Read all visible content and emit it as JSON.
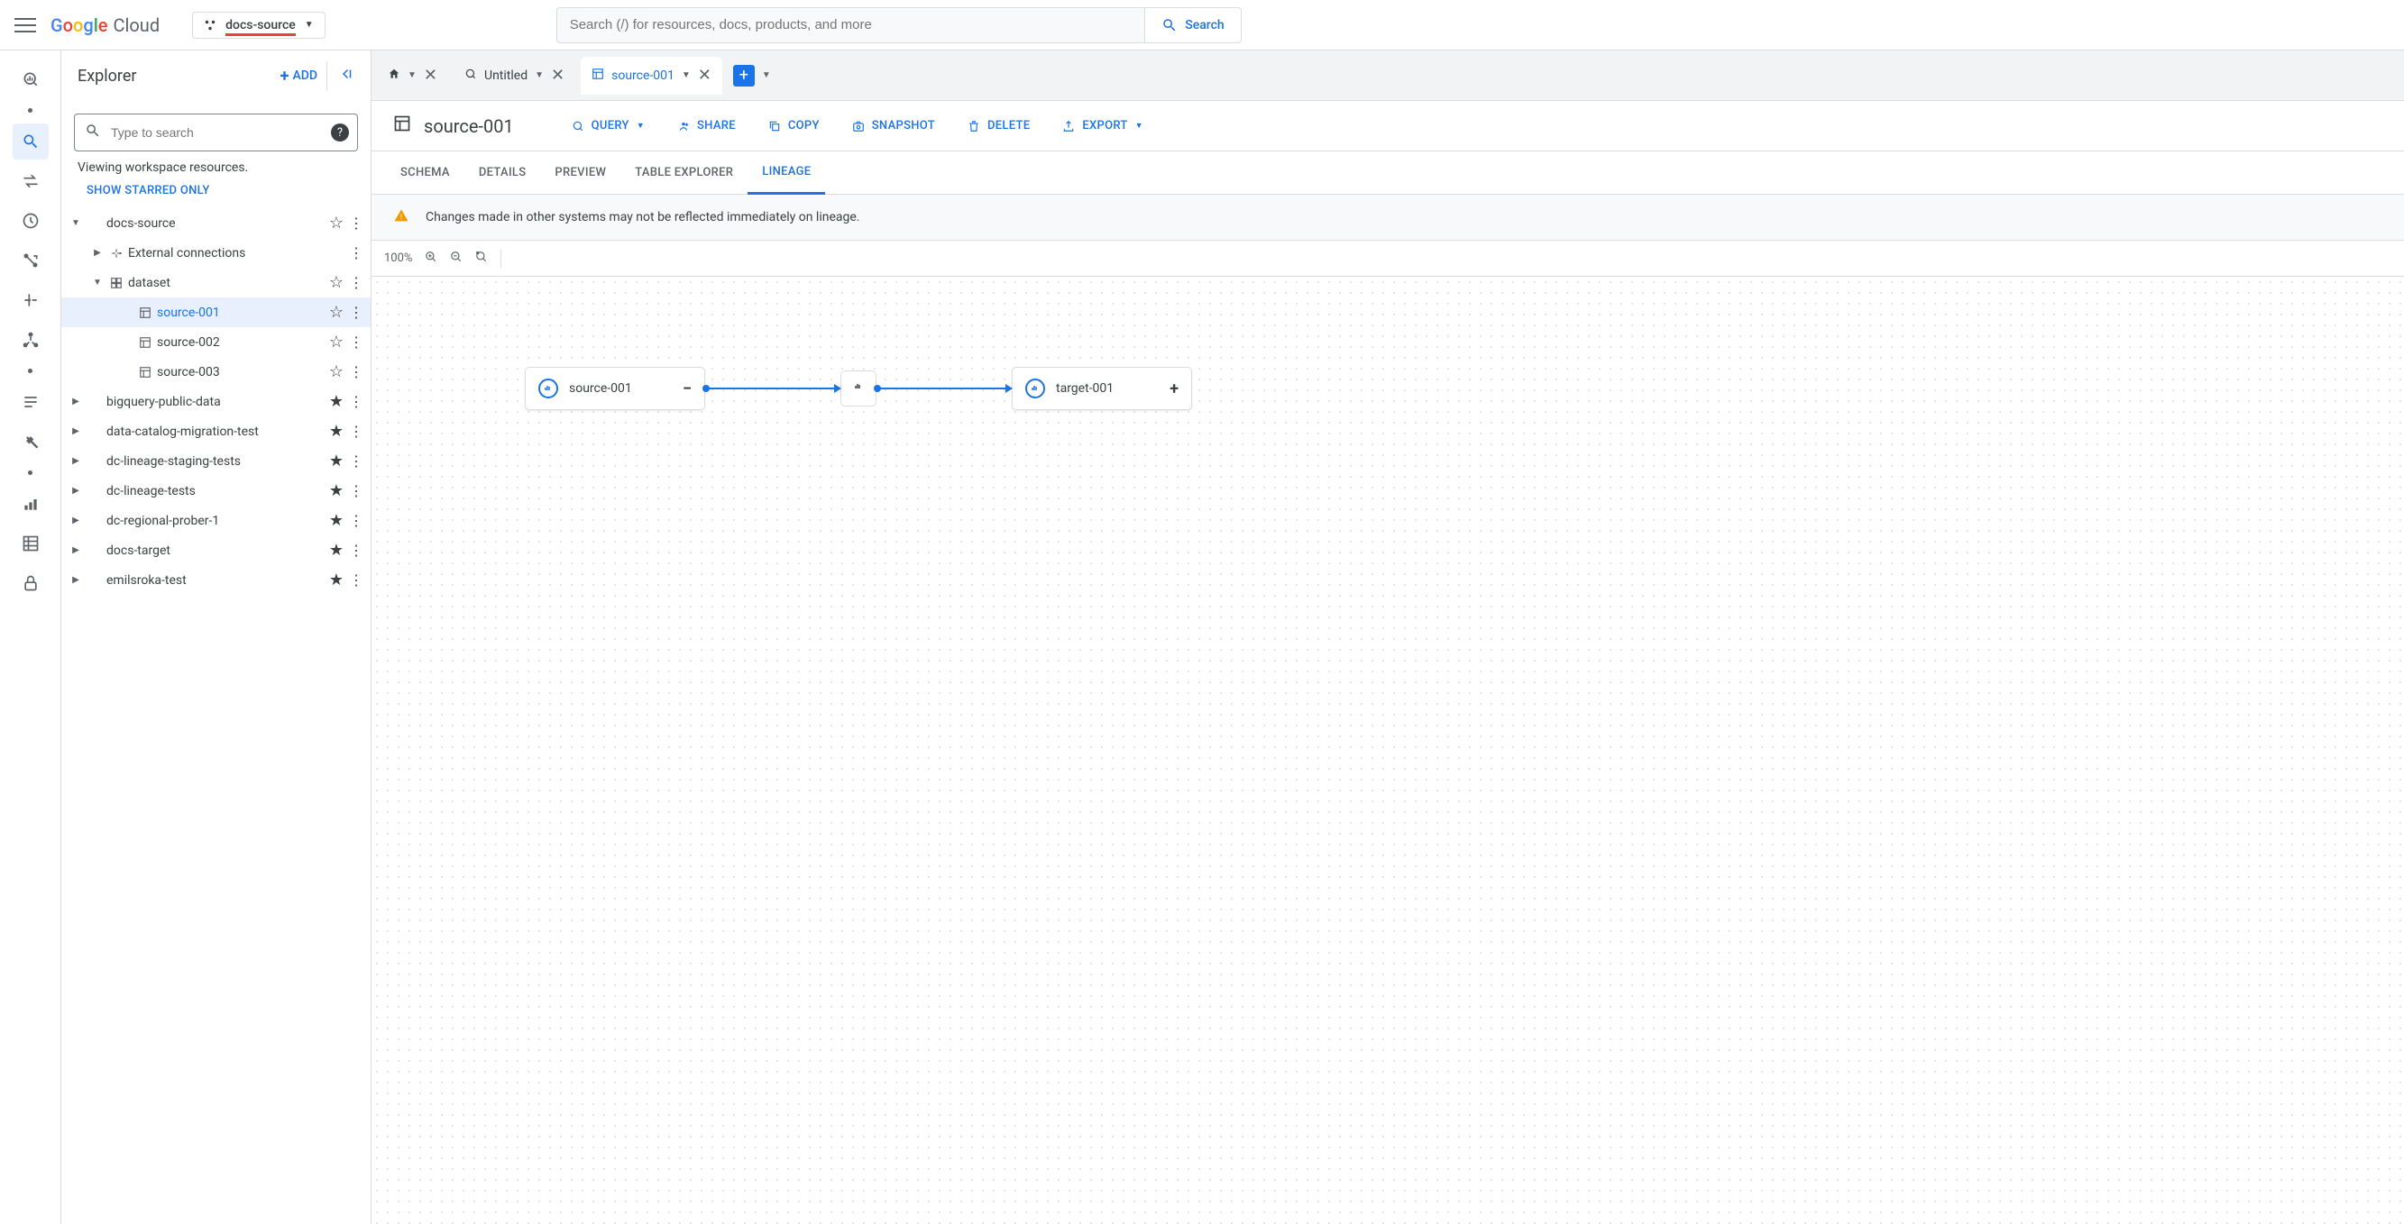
{
  "topbar": {
    "logo_text": "Cloud",
    "project": "docs-source",
    "search_placeholder": "Search (/) for resources, docs, products, and more",
    "search_label": "Search"
  },
  "explorer": {
    "title": "Explorer",
    "add_label": "ADD",
    "search_placeholder": "Type to search",
    "viewing_text": "Viewing workspace resources.",
    "show_starred": "SHOW STARRED ONLY",
    "tree": {
      "root": "docs-source",
      "ext_conn": "External connections",
      "dataset": "dataset",
      "src1": "source-001",
      "src2": "source-002",
      "src3": "source-003",
      "bq": "bigquery-public-data",
      "dcm": "data-catalog-migration-test",
      "dls": "dc-lineage-staging-tests",
      "dlt": "dc-lineage-tests",
      "drp": "dc-regional-prober-1",
      "dt": "docs-target",
      "em": "emilsroka-test"
    }
  },
  "tabs": {
    "untitled": "Untitled",
    "src": "source-001"
  },
  "page": {
    "title": "source-001",
    "query": "QUERY",
    "share": "SHARE",
    "copy": "COPY",
    "snapshot": "SNAPSHOT",
    "delete": "DELETE",
    "export": "EXPORT"
  },
  "subtabs": {
    "schema": "SCHEMA",
    "details": "DETAILS",
    "preview": "PREVIEW",
    "tableexp": "TABLE EXPLORER",
    "lineage": "LINEAGE"
  },
  "warning": "Changes made in other systems may not be reflected immediately on lineage.",
  "toolbar": {
    "zoom": "100%"
  },
  "lineage": {
    "source": "source-001",
    "target": "target-001"
  }
}
